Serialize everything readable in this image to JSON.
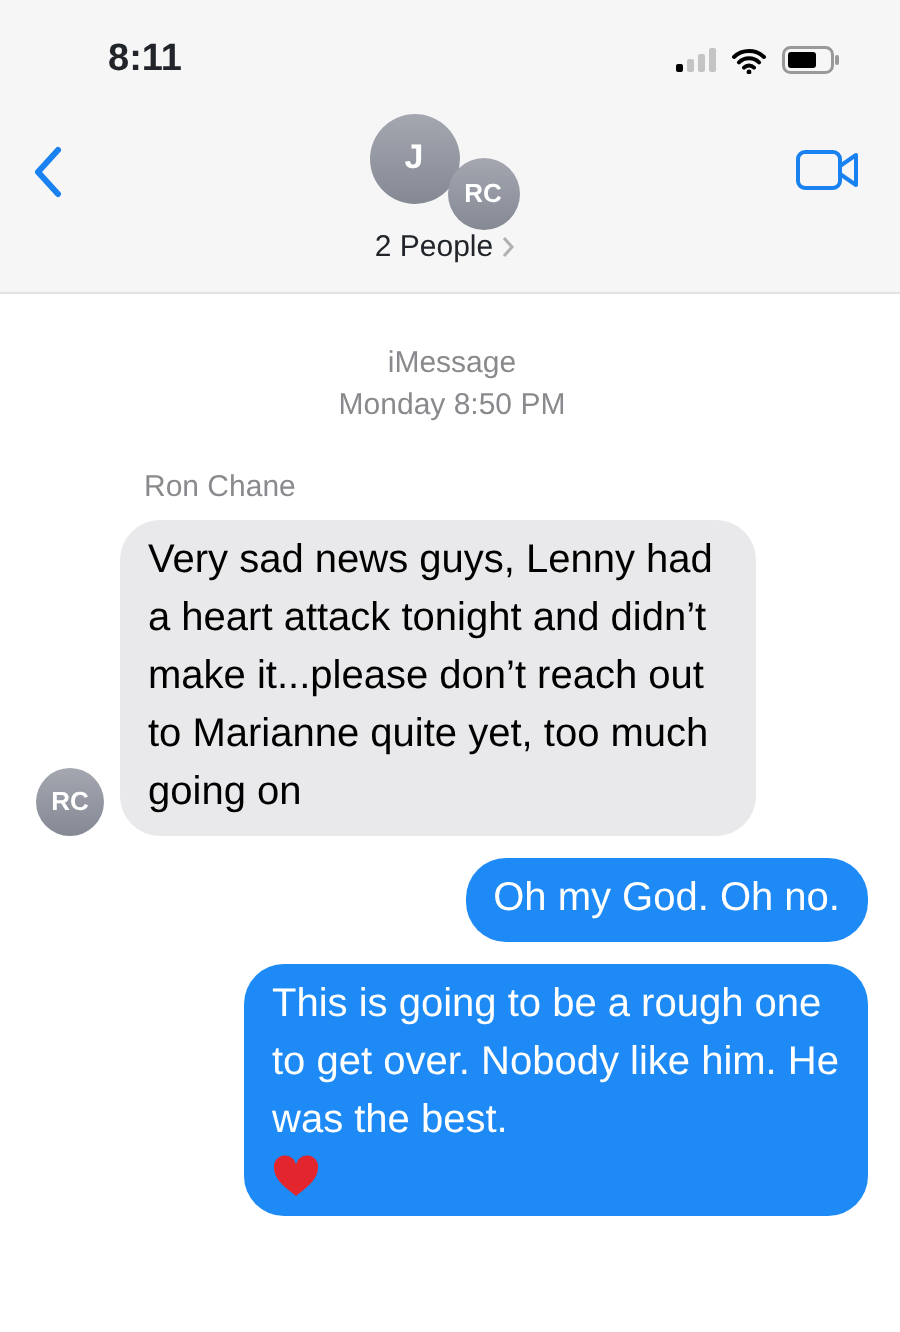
{
  "status_bar": {
    "time": "8:11"
  },
  "header": {
    "avatars": [
      {
        "initials": "J"
      },
      {
        "initials": "RC"
      }
    ],
    "title": "2 People"
  },
  "thread": {
    "service": "iMessage",
    "timestamp": "Monday 8:50 PM"
  },
  "messages": [
    {
      "kind": "incoming",
      "sender": "Ron Chane",
      "avatar": "RC",
      "text": "Very sad news guys, Lenny had a heart attack tonight and didn’t make it...please don’t reach out to Marianne quite yet, too much going on"
    },
    {
      "kind": "outgoing",
      "text": "Oh my God. Oh no.",
      "heart": false
    },
    {
      "kind": "outgoing",
      "text": "This is going to be a rough one to get over. Nobody like him. He was the best.",
      "heart": true
    }
  ]
}
